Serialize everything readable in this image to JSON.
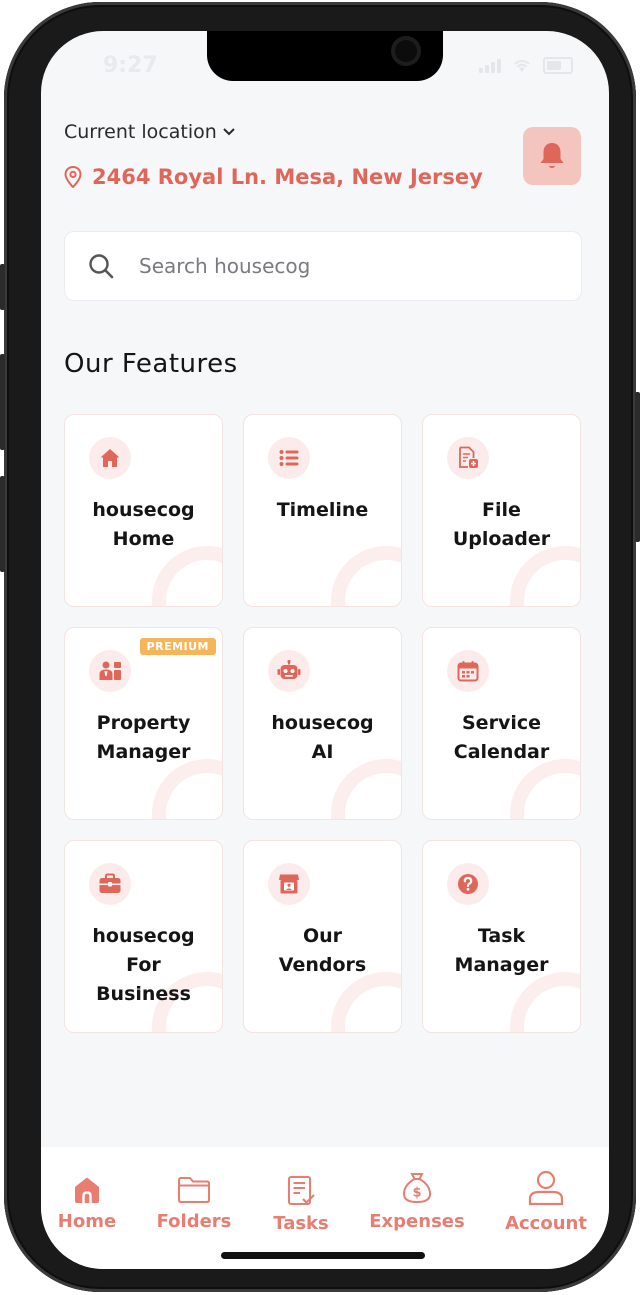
{
  "status_bar": {
    "time": "9:27"
  },
  "location": {
    "label": "Current location",
    "address": "2464 Royal Ln. Mesa, New Jersey"
  },
  "search": {
    "placeholder": "Search housecog"
  },
  "section_title": "Our Features",
  "features": [
    {
      "label": "housecog\nHome",
      "icon": "home-icon"
    },
    {
      "label": "Timeline",
      "icon": "list-icon"
    },
    {
      "label": "File\nUploader",
      "icon": "file-upload-icon"
    },
    {
      "label": "Property\nManager",
      "icon": "property-manager-icon",
      "badge": "PREMIUM"
    },
    {
      "label": "housecog\nAI",
      "icon": "robot-icon"
    },
    {
      "label": "Service\nCalendar",
      "icon": "calendar-icon"
    },
    {
      "label": "housecog\nFor\nBusiness",
      "icon": "briefcase-icon"
    },
    {
      "label": "Our\nVendors",
      "icon": "vendor-store-icon"
    },
    {
      "label": "Task\nManager",
      "icon": "question-icon"
    }
  ],
  "tabs": [
    {
      "label": "Home",
      "icon": "home-icon"
    },
    {
      "label": "Folders",
      "icon": "folder-icon"
    },
    {
      "label": "Tasks",
      "icon": "tasks-icon"
    },
    {
      "label": "Expenses",
      "icon": "money-bag-icon"
    },
    {
      "label": "Account",
      "icon": "user-icon"
    }
  ],
  "colors": {
    "accent": "#e0665a",
    "accent_light": "#f4c4be",
    "badge": "#f7b55a"
  }
}
